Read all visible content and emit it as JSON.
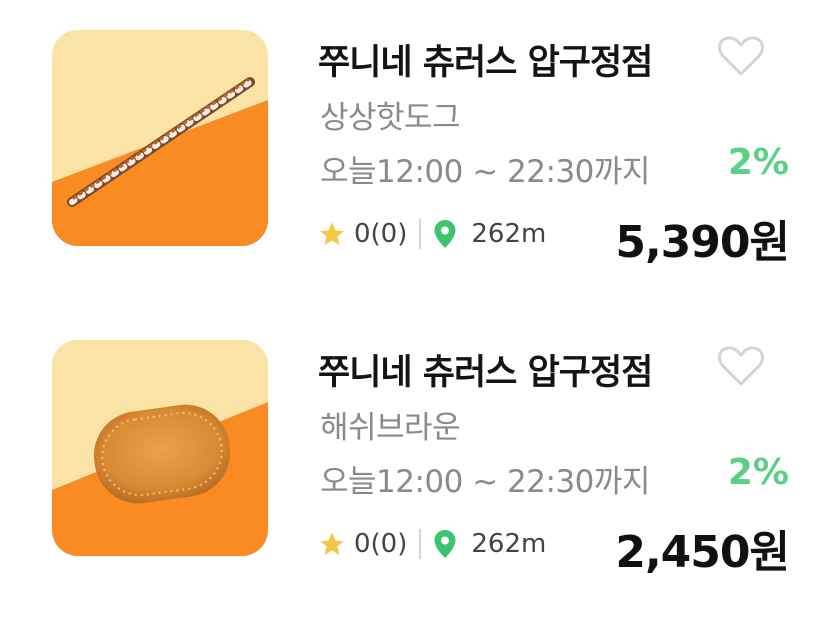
{
  "items": [
    {
      "store_name": "쭈니네 츄러스 압구정점",
      "menu_name": "상상핫도그",
      "hours": "오늘12:00 ~ 22:30까지",
      "discount": "2%",
      "rating": "0(0)",
      "distance": "262m",
      "price": "5,390원",
      "thumbnail_icon": "hotdog-image"
    },
    {
      "store_name": "쭈니네 츄러스 압구정점",
      "menu_name": "해쉬브라운",
      "hours": "오늘12:00 ~ 22:30까지",
      "discount": "2%",
      "rating": "0(0)",
      "distance": "262m",
      "price": "2,450원",
      "thumbnail_icon": "hashbrown-image"
    }
  ],
  "colors": {
    "discount": "#5bcf85",
    "star": "#f3c744",
    "pin": "#3cc46f",
    "thumb_light": "#fbe3a6",
    "thumb_orange": "#fa8a22"
  }
}
